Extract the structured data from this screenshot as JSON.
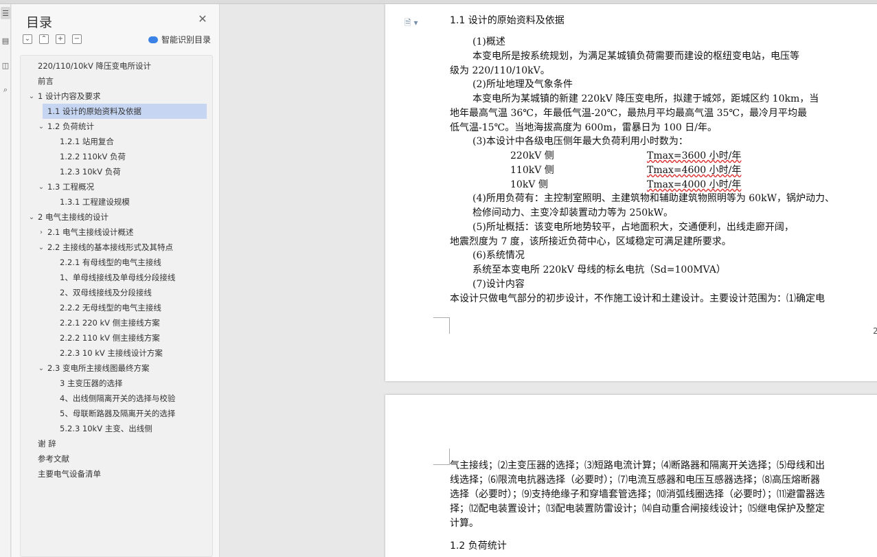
{
  "sidebar_icons": [
    "toc-icon",
    "page-icon",
    "bookmark-icon",
    "find-icon"
  ],
  "toc": {
    "title": "目录",
    "smart_label": "智能识别目录",
    "tools": [
      "collapse",
      "expand-level",
      "add",
      "remove"
    ],
    "items": [
      {
        "label": "220/110/10kV 降压变电所设计",
        "level": 0,
        "chev": ""
      },
      {
        "label": "前言",
        "level": 0,
        "chev": ""
      },
      {
        "label": "1  设计内容及要求",
        "level": 0,
        "chev": "open"
      },
      {
        "label": "1.1  设计的原始资料及依据",
        "level": 1,
        "chev": "",
        "selected": true
      },
      {
        "label": "1.2  负荷统计",
        "level": 1,
        "chev": "open"
      },
      {
        "label": "1.2.1  站用复合",
        "level": 2,
        "chev": ""
      },
      {
        "label": "1.2.2 110kV 负荷",
        "level": 2,
        "chev": ""
      },
      {
        "label": "1.2.3 10kV 负荷",
        "level": 2,
        "chev": ""
      },
      {
        "label": "1.3  工程概况",
        "level": 1,
        "chev": "open"
      },
      {
        "label": "1.3.1  工程建设规模",
        "level": 2,
        "chev": ""
      },
      {
        "label": "2  电气主接线的设计",
        "level": 0,
        "chev": "open"
      },
      {
        "label": "2.1  电气主接线设计概述",
        "level": 1,
        "chev": "closed"
      },
      {
        "label": "2.2    主接线的基本接线形式及其特点",
        "level": 1,
        "chev": "open"
      },
      {
        "label": "2.2.1  有母线型的电气主接线",
        "level": 2,
        "chev": ""
      },
      {
        "label": "1、单母线接线及单母线分段接线",
        "level": 2,
        "chev": ""
      },
      {
        "label": "2、双母线接线及分段接线",
        "level": 2,
        "chev": ""
      },
      {
        "label": "2.2.2  无母线型的电气主接线",
        "level": 2,
        "chev": ""
      },
      {
        "label": "2.2.1 220 kV 侧主接线方案",
        "level": 2,
        "chev": ""
      },
      {
        "label": "2.2.2 110 kV 侧主接线方案",
        "level": 2,
        "chev": ""
      },
      {
        "label": "2.2.3    10 kV 主接线设计方案",
        "level": 2,
        "chev": ""
      },
      {
        "label": "2.3 变电所主接线图最终方案",
        "level": 1,
        "chev": "open"
      },
      {
        "label": "3  主变压器的选择",
        "level": 2,
        "chev": ""
      },
      {
        "label": "4、出线侧隔离开关的选择与校验",
        "level": 2,
        "chev": ""
      },
      {
        "label": "5、母联断路器及隔离开关的选择",
        "level": 2,
        "chev": ""
      },
      {
        "label": "5.2.3 10kV 主变、出线侧",
        "level": 2,
        "chev": ""
      },
      {
        "label": "谢    辞",
        "level": 0,
        "chev": ""
      },
      {
        "label": "参考文献",
        "level": 0,
        "chev": ""
      },
      {
        "label": "主要电气设备清单",
        "level": 0,
        "chev": ""
      }
    ]
  },
  "page1": {
    "heading": "1.1  设计的原始资料及依据",
    "s1": "(1)概述",
    "p1a": "本变电所是按系统规划，为满足某城镇负荷需要而建设的枢纽变电站，电压等",
    "p1b": "级为 220/110/10kV。",
    "s2": "(2)所址地理及气象条件",
    "p2a": "本变电所为某城镇的新建 220kV 降压变电所，拟建于城郊，距城区约 10km，当",
    "p2b": "地年最高气温 36℃，年最低气温-20℃，最热月平均最高气温 35℃，最冷月平均最",
    "p2c": "低气温-15℃。当地海拔高度为 600m，雷暴日为 100 日/年。",
    "s3": "(3)本设计中各级电压侧年最大负荷利用小时数为：",
    "rows": [
      {
        "side": "220kV 侧",
        "value": "Tmax=3600 小时/年"
      },
      {
        "side": "110kV 侧",
        "value": "Tmax=4600 小时/年"
      },
      {
        "side": "10kV 侧",
        "value": "Tmax=4000 小时/年"
      }
    ],
    "p4a": "(4)所用负荷有：主控制室照明、主建筑物和辅助建筑物照明等为 60kW，锅炉动力、",
    "p4b": "检修间动力、主变冷却装置动力等为 250kW。",
    "p5a": "(5)所址概括：该变电所地势较平，占地面积大，交通便利，出线走廊开阔，",
    "p5b": "地震烈度为 7 度，该所接近负荷中心，区域稳定可满足建所要求。",
    "s6": "(6)系统情况",
    "p6": "系统至本变电所 220kV 母线的标幺电抗（Sd=100MVA）",
    "s7": "(7)设计内容",
    "p7": "本设计只做电气部分的初步设计，不作施工设计和土建设计。主要设计范围为：⑴确定电",
    "page_number": "2"
  },
  "page2": {
    "l1": "气主接线；⑵主变压器的选择；⑶短路电流计算；⑷断路器和隔离开关选择；⑸母线和出",
    "l2": "线选择；⑹限流电抗器选择（必要时）；⑺电流互感器和电压互感器选择；⑻高压熔断器",
    "l3": "选择（必要时）；⑼支持绝缘子和穿墙套管选择；⑽消弧线圈选择（必要时）；⑾避雷器选",
    "l4": "择；⑿配电装置设计；⒀配电装置防雷设计；⒁自动重合闸接线设计；⒂继电保护及整定",
    "l5": "计算。",
    "heading": "1.2  负荷统计"
  }
}
